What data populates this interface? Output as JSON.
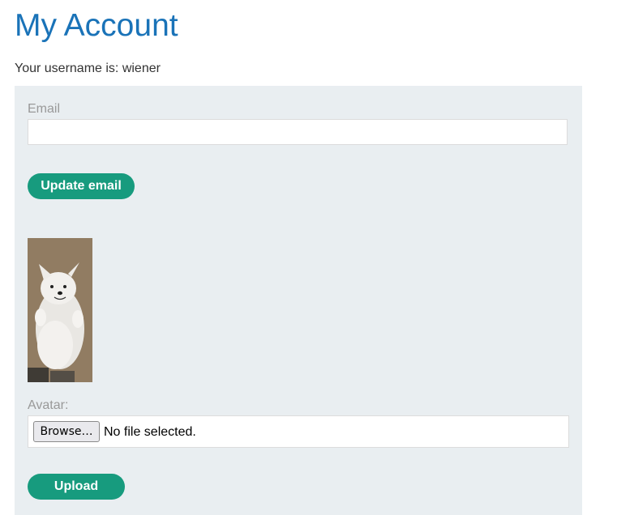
{
  "page": {
    "title": "My Account",
    "username_line": "Your username is: wiener"
  },
  "email_form": {
    "label": "Email",
    "value": "",
    "placeholder": "",
    "submit_label": "Update email"
  },
  "avatar_form": {
    "image_icon": "dog-photo",
    "label": "Avatar:",
    "browse_label": "Browse…",
    "file_status": "No file selected.",
    "submit_label": "Upload"
  },
  "colors": {
    "title": "#1a73b8",
    "panel_bg": "#e9eef1",
    "button_bg": "#179b7e",
    "label_text": "#999999"
  }
}
